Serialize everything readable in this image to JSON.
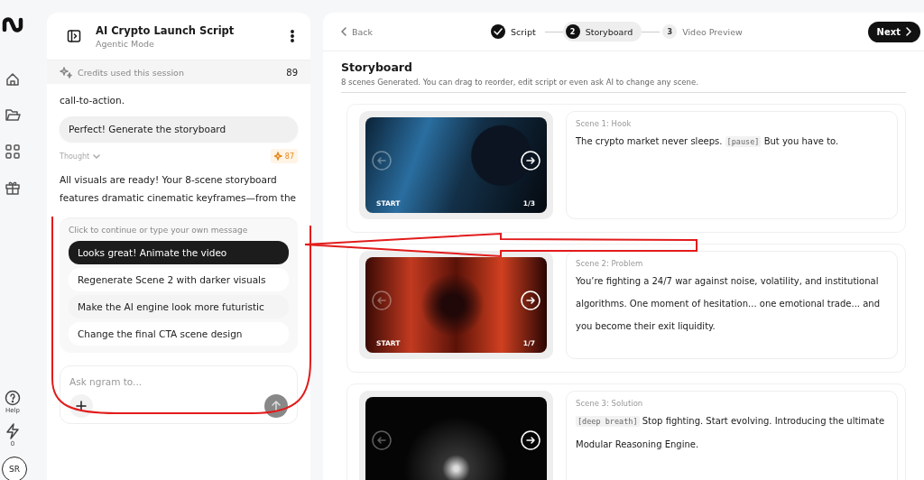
{
  "rail": {
    "items": [
      {
        "kind": "home"
      },
      {
        "kind": "folder"
      },
      {
        "kind": "grid"
      },
      {
        "kind": "gift"
      }
    ],
    "help": {
      "label": "Help"
    },
    "energy": {
      "count": "0"
    },
    "avatar": {
      "initials": "SR"
    }
  },
  "chat": {
    "title": "AI Crypto Launch Script",
    "subtitle": "Agentic Mode",
    "credits": {
      "label": "Credits used this session",
      "value": "89"
    },
    "messages": [
      {
        "kind": "assistant",
        "text": "call-to-action."
      },
      {
        "kind": "user",
        "text": "Perfect! Generate the storyboard"
      },
      {
        "kind": "thought",
        "label": "Thought",
        "credits": "87"
      },
      {
        "kind": "assistant",
        "text": "All visuals are ready! Your 8-scene storyboard features dramatic cinematic keyframes—from the"
      }
    ],
    "suggestions": {
      "hint": "Click to continue or type your own message",
      "items": [
        {
          "text": "Looks great! Animate the video",
          "selected": true
        },
        {
          "text": "Regenerate Scene 2 with darker visuals",
          "selected": false
        },
        {
          "text": "Make the AI engine look more futuristic",
          "selected": false
        },
        {
          "text": "Change the final CTA scene design",
          "selected": false
        }
      ]
    },
    "input": {
      "placeholder": "Ask ngram to..."
    }
  },
  "editor": {
    "back": "Back",
    "steps": [
      {
        "label": "Script",
        "completed": true,
        "selected": false
      },
      {
        "number": "2",
        "label": "Storyboard",
        "completed": false,
        "selected": true
      },
      {
        "number": "3",
        "label": "Video Preview",
        "completed": false,
        "selected": false
      }
    ],
    "next": "Next",
    "heading": "Storyboard",
    "description": "8 scenes Generated. You can drag to reorder, edit script or even ask AI to change any scene.",
    "scenes": [
      {
        "title": "Scene 1: Hook",
        "start": "START",
        "counter": "1/3",
        "script": [
          {
            "kind": "text",
            "text": "The crypto market never sleeps."
          },
          {
            "kind": "cue",
            "text": "[pause]"
          },
          {
            "kind": "text",
            "text": "But you have to."
          }
        ]
      },
      {
        "title": "Scene 2: Problem",
        "start": "START",
        "counter": "1/7",
        "script": [
          {
            "kind": "text",
            "text": "You’re fighting a 24/7 war against noise, volatility, and institutional algorithms. One moment of hesitation... one emotional trade... and you become their exit liquidity."
          }
        ]
      },
      {
        "title": "Scene 3: Solution",
        "script": [
          {
            "kind": "cue",
            "text": "[deep breath]"
          },
          {
            "kind": "text",
            "text": "Stop fighting. Start evolving. Introducing the ultimate Modular Reasoning Engine."
          }
        ]
      }
    ]
  },
  "callout": {
    "outline": true,
    "arrow": true
  }
}
